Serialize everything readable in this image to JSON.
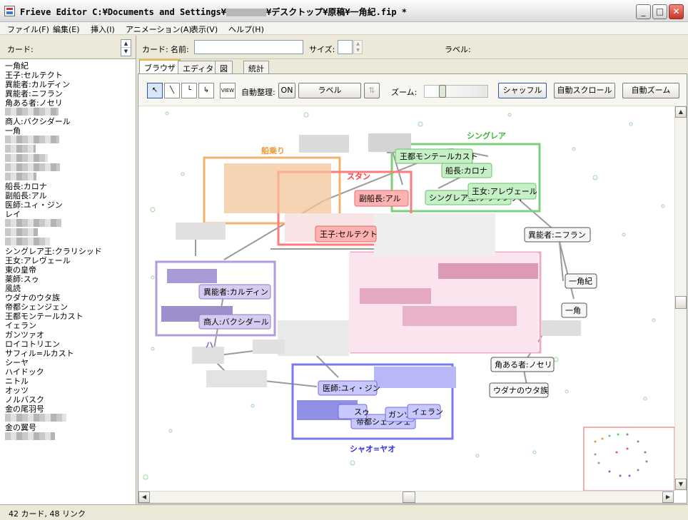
{
  "window": {
    "title_prefix": "Frieve Editor C:¥Documents and Settings¥",
    "title_suffix": "¥デスクトップ¥原稿¥一角紀.fip *",
    "min_glyph": "_",
    "max_glyph": "□",
    "close_glyph": "✕"
  },
  "menu": {
    "file": "ファイル(F)",
    "edit": "編集(E)",
    "insert": "挿入(I)",
    "animation": "アニメーション(A)",
    "view": "表示(V)",
    "help": "ヘルプ(H)"
  },
  "left": {
    "header_label": "カード:",
    "cards": [
      "一角紀",
      "王子:セルテクト",
      "異能者:カルディン",
      "異能者:ニフラン",
      "角ある者:ノセリ",
      "",
      "商人:バクシダール",
      "一角",
      "",
      "",
      "",
      "",
      "",
      "船長:カロナ",
      "副船長:アル",
      "医師:ユィ・ジン",
      "レイ",
      "",
      "",
      "",
      "シングレア王:クラリシッド",
      "王女:アレヴェール",
      "東の皇帝",
      "薬師:スゥ",
      "風読",
      "ウダナのウタ族",
      "帝都シェンジェン",
      "王都モンテールカスト",
      "イェラン",
      "ガンツァオ",
      "ロイコトリエン",
      "サフィル=ルカスト",
      "シーヤ",
      "ハイドック",
      "ニトル",
      "オッツ",
      "ノルバスク",
      "金の尾羽号",
      "",
      "金の翼号",
      ""
    ],
    "status": "42 カード, 48 リンク"
  },
  "fields": {
    "card_label": "カード:",
    "name_label": "名前:",
    "name_value": "",
    "size_label": "サイズ:",
    "size_value": "",
    "label_label": "ラベル:"
  },
  "tabs": [
    "ブラウザ",
    "エディタ",
    "図",
    "統計"
  ],
  "toolbar": {
    "view_label": "VIEW",
    "auto_arrange_label": "自動整理:",
    "on_label": "ON",
    "label_button": "ラベル",
    "zoom_label": "ズーム:",
    "zoom_level": 0.25,
    "shuffle": "シャッフル",
    "auto_scroll": "自動スクロール",
    "auto_zoom": "自動ズーム"
  },
  "groups": {
    "shingrea": "シングレア",
    "funanori": "船乗り",
    "ustan": "スタン",
    "shao": "シャオ=ヤオ",
    "purple_small": "ハ"
  },
  "nodes": {
    "outouMonte": "王都モンテールカスト",
    "senchoKarona": "船長:カロナ",
    "oujoAreveru": "王女:アレヴェール",
    "shingreaOu": "シングレア王:クラリシッド",
    "fukusencho": "副船長:アル",
    "ojiSerutekuto": "王子:セルテクト",
    "inouNifuran": "異能者:ニフラン",
    "ikkakuki": "一角紀",
    "ikkaku": "一角",
    "inouKarudin": "異能者:カルディン",
    "shoninBakushidaru": "商人:バクシダール",
    "tsunoNoseri": "角ある者:ノセリ",
    "udana": "ウダナのウタ族",
    "ishiYuijin": "医師:ユィ・ジン",
    "yakushiSu": "スゥ",
    "ganz": "ガンツ",
    "ieran": "イェラン",
    "teitoShenjen": "帝都シェンジェ"
  },
  "colors": {
    "green": "#7cd07c",
    "orange": "#f5b26b",
    "red": "#ff7a7a",
    "purple": "#b39cdc",
    "blue": "#7878f0",
    "pink": "#f3a9c6"
  }
}
